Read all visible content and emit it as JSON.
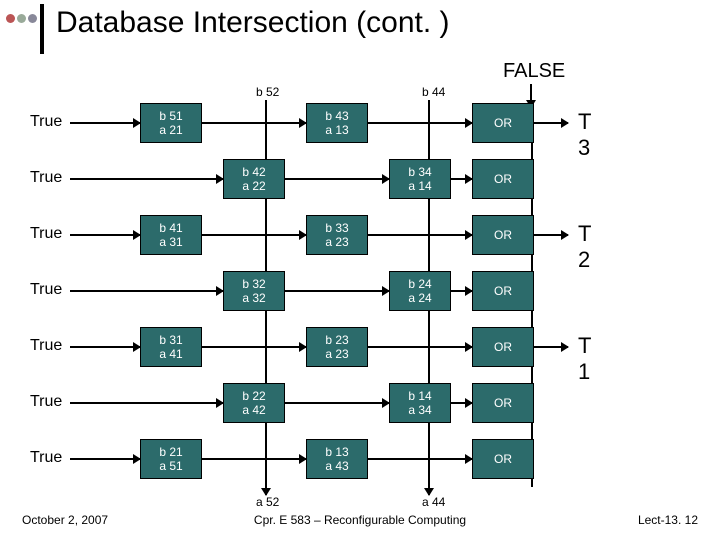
{
  "title": "Database Intersection (cont. )",
  "false_label": "FALSE",
  "top_labels": {
    "b52": "b 52",
    "b44": "b 44"
  },
  "rows": [
    {
      "true": "True",
      "c1": {
        "t": "b 51",
        "b": "a 21"
      },
      "c2": null,
      "c3": {
        "t": "b 43",
        "b": "a 13"
      },
      "c4": null,
      "or": "OR",
      "t": "T 3"
    },
    {
      "true": "True",
      "c1": null,
      "c2": {
        "t": "b 42",
        "b": "a 22"
      },
      "c3": null,
      "c4": {
        "t": "b 34",
        "b": "a 14"
      },
      "or": "OR",
      "t": null
    },
    {
      "true": "True",
      "c1": {
        "t": "b 41",
        "b": "a 31"
      },
      "c2": null,
      "c3": {
        "t": "b 33",
        "b": "a 23"
      },
      "c4": null,
      "or": "OR",
      "t": "T 2"
    },
    {
      "true": "True",
      "c1": null,
      "c2": {
        "t": "b 32",
        "b": "a 32"
      },
      "c3": null,
      "c4": {
        "t": "b 24",
        "b": "a 24"
      },
      "or": "OR",
      "t": null
    },
    {
      "true": "True",
      "c1": {
        "t": "b 31",
        "b": "a 41"
      },
      "c2": null,
      "c3": {
        "t": "b 23",
        "b": "a 23"
      },
      "c4": null,
      "or": "OR",
      "t": "T 1"
    },
    {
      "true": "True",
      "c1": null,
      "c2": {
        "t": "b 22",
        "b": "a 42"
      },
      "c3": null,
      "c4": {
        "t": "b 14",
        "b": "a 34"
      },
      "or": "OR",
      "t": null
    },
    {
      "true": "True",
      "c1": {
        "t": "b 21",
        "b": "a 51"
      },
      "c2": null,
      "c3": {
        "t": "b 13",
        "b": "a 43"
      },
      "c4": null,
      "or": "OR",
      "t": null
    }
  ],
  "bottom_labels": {
    "a52": "a 52",
    "a44": "a 44"
  },
  "footer": {
    "left": "October 2, 2007",
    "center": "Cpr. E 583 – Reconfigurable Computing",
    "right": "Lect-13. 12"
  }
}
